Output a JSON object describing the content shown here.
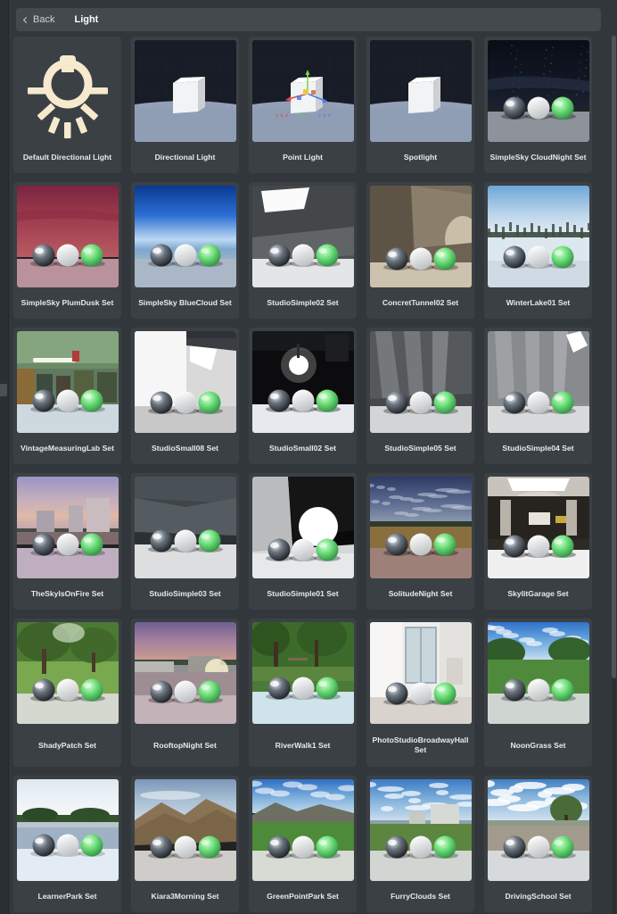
{
  "window": {
    "background": "#32373b"
  },
  "header": {
    "back_label": "Back",
    "back_icon": "chevron-left-icon",
    "title": "Light"
  },
  "accent_colors": {
    "card_bg": "#3b4045",
    "panel_bg": "#32373b",
    "header_bg": "#44494e",
    "label_text": "#e8eaec",
    "bulb_icon": "#f6e9cd",
    "sphere_green": "#6ede7a"
  },
  "grid": {
    "columns": 5,
    "rows": [
      {
        "tall": false,
        "items": [
          {
            "label": "Default Directional Light",
            "thumb": "bulb-icon"
          },
          {
            "label": "Directional Light",
            "thumb": "cube-night"
          },
          {
            "label": "Point Light",
            "thumb": "cube-gizmo"
          },
          {
            "label": "Spotlight",
            "thumb": "cube-night"
          },
          {
            "label": "SimpleSky CloudNight Set",
            "thumb": "sky-cloudnight"
          }
        ]
      },
      {
        "tall": false,
        "items": [
          {
            "label": "SimpleSky PlumDusk Set",
            "thumb": "sky-plumdusk"
          },
          {
            "label": "SimpleSky BlueCloud Set",
            "thumb": "sky-bluecloud"
          },
          {
            "label": "StudioSimple02 Set",
            "thumb": "studio-simple02"
          },
          {
            "label": "ConcretTunnel02 Set",
            "thumb": "concrete-tunnel"
          },
          {
            "label": "WinterLake01 Set",
            "thumb": "winter-lake"
          }
        ]
      },
      {
        "tall": false,
        "items": [
          {
            "label": "VintageMeasuringLab Set",
            "thumb": "vintage-lab"
          },
          {
            "label": "StudioSmall08 Set",
            "thumb": "studio-small08"
          },
          {
            "label": "StudioSmall02 Set",
            "thumb": "studio-small02"
          },
          {
            "label": "StudioSimple05 Set",
            "thumb": "studio-simple05"
          },
          {
            "label": "StudioSimple04 Set",
            "thumb": "studio-simple04"
          }
        ]
      },
      {
        "tall": false,
        "items": [
          {
            "label": "TheSkyIsOnFire Set",
            "thumb": "sky-onfire"
          },
          {
            "label": "StudioSimple03 Set",
            "thumb": "studio-simple03"
          },
          {
            "label": "StudioSimple01 Set",
            "thumb": "studio-simple01"
          },
          {
            "label": "SolitudeNight Set",
            "thumb": "solitude-night"
          },
          {
            "label": "SkylitGarage Set",
            "thumb": "skylit-garage"
          }
        ]
      },
      {
        "tall": true,
        "items": [
          {
            "label": "ShadyPatch Set",
            "thumb": "shady-patch"
          },
          {
            "label": "RooftopNight Set",
            "thumb": "rooftop-night"
          },
          {
            "label": "RiverWalk1 Set",
            "thumb": "river-walk"
          },
          {
            "label": "PhotoStudioBroadwayHall Set",
            "thumb": "photo-studio"
          },
          {
            "label": "NoonGrass Set",
            "thumb": "noon-grass"
          }
        ]
      },
      {
        "tall": false,
        "items": [
          {
            "label": "LearnerPark Set",
            "thumb": "learner-park"
          },
          {
            "label": "Kiara3Morning Set",
            "thumb": "kiara3-morning"
          },
          {
            "label": "GreenPointPark Set",
            "thumb": "greenpoint-park"
          },
          {
            "label": "FurryClouds Set",
            "thumb": "furry-clouds"
          },
          {
            "label": "DrivingSchool Set",
            "thumb": "driving-school"
          }
        ]
      }
    ]
  }
}
